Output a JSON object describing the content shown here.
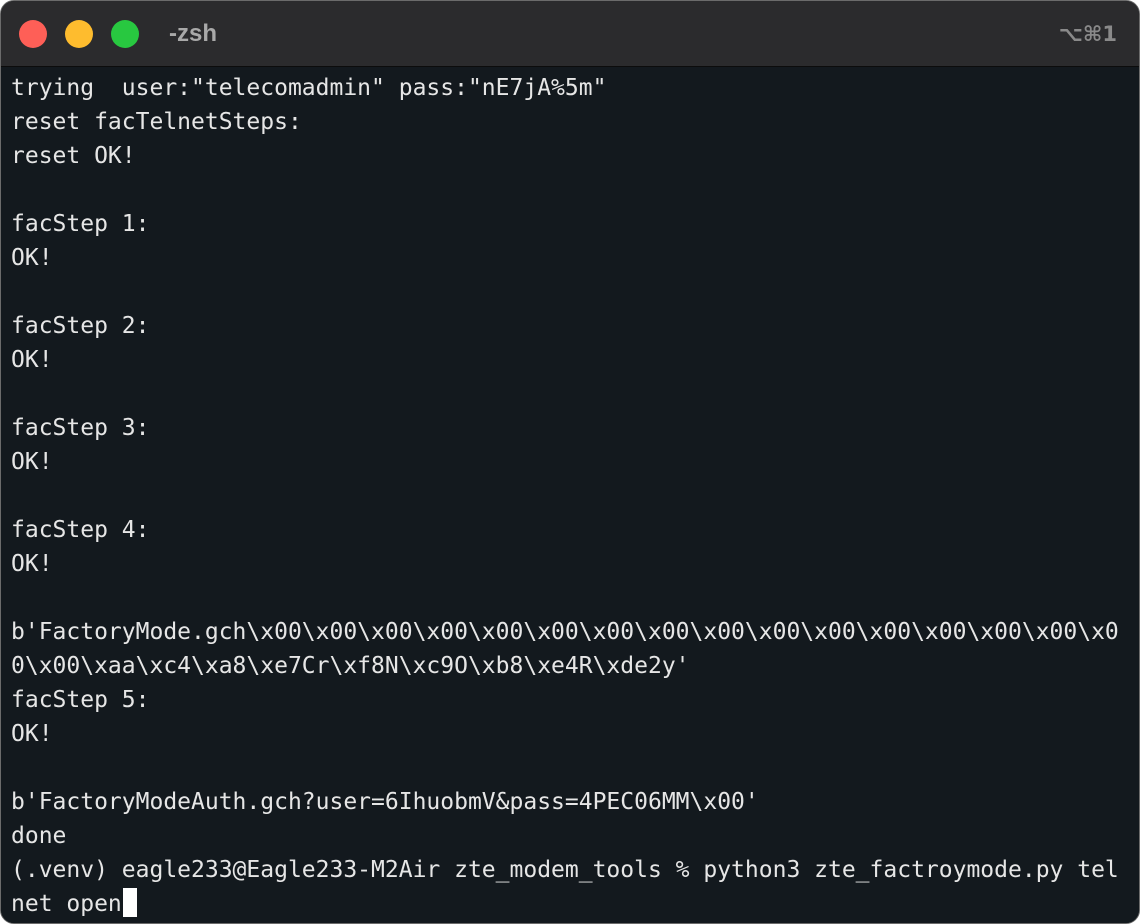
{
  "window": {
    "title": "-zsh",
    "shortcut": "⌥⌘1"
  },
  "terminal": {
    "lines": [
      "trying  user:\"telecomadmin\" pass:\"nE7jA%5m\"",
      "reset facTelnetSteps:",
      "reset OK!",
      "",
      "facStep 1:",
      "OK!",
      "",
      "facStep 2:",
      "OK!",
      "",
      "facStep 3:",
      "OK!",
      "",
      "facStep 4:",
      "OK!",
      "",
      "b'FactoryMode.gch\\x00\\x00\\x00\\x00\\x00\\x00\\x00\\x00\\x00\\x00\\x00\\x00\\x00\\x00\\x00\\x0",
      "0\\x00\\xaa\\xc4\\xa8\\xe7Cr\\xf8N\\xc9O\\xb8\\xe4R\\xde2y'",
      "facStep 5:",
      "OK!",
      "",
      "b'FactoryModeAuth.gch?user=6IhuobmV&pass=4PEC06MM\\x00'",
      "done",
      "(.venv) eagle233@Eagle233-M2Air zte_modem_tools % python3 zte_factroymode.py tel",
      "net open"
    ]
  },
  "colors": {
    "background": "#13191e",
    "text": "#e6e6e6",
    "titlebar": "#2b2b2d",
    "close": "#fe5f57",
    "minimize": "#febc2e",
    "zoom": "#28c840"
  }
}
